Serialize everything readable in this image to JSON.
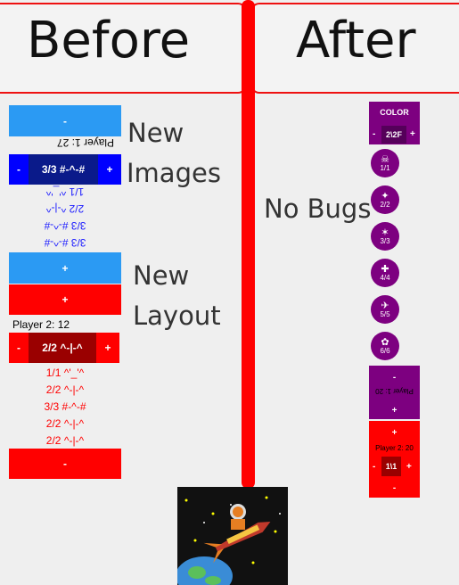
{
  "header": {
    "before": "Before",
    "after": "After"
  },
  "labels": {
    "new_images_1": "New",
    "new_images_2": "Images",
    "new_layout_1": "New",
    "new_layout_2": "Layout",
    "no_bugs": "No Bugs"
  },
  "before": {
    "p1": {
      "minus": "-",
      "name": "Player 1: 27",
      "dec": "-",
      "counter": "3/3 #-^-#",
      "inc": "+",
      "history": [
        "1/1 ^'_'^",
        "2/2 ^-|-^",
        "3/3 #-^-#",
        "3/3 #-^-#"
      ],
      "plus": "+"
    },
    "p2": {
      "plus": "+",
      "name": "Player 2:  12",
      "dec": "-",
      "counter": "2/2 ^-|-^",
      "inc": "+",
      "history": [
        "1/1 ^'_'^",
        "2/2 ^-|-^",
        "3/3 #-^-#",
        "2/2 ^-|-^",
        "2/2 ^-|-^"
      ],
      "minus": "-"
    }
  },
  "after": {
    "color_label": "COLOR",
    "top_dec": "-",
    "top_counter": "2\\2F",
    "top_inc": "+",
    "circles": [
      {
        "glyph": "☠",
        "text": "1/1"
      },
      {
        "glyph": "✦",
        "text": "2/2"
      },
      {
        "glyph": "✶",
        "text": "3/3"
      },
      {
        "glyph": "✚",
        "text": "4/4"
      },
      {
        "glyph": "✈",
        "text": "5/5"
      },
      {
        "glyph": "✿",
        "text": "6/6"
      }
    ],
    "p1_minus": "-",
    "p1_name": "Player 1: 20",
    "p1_plus": "+",
    "p2_plus": "+",
    "p2_name": "Player 2: 20",
    "p2_dec": "-",
    "p2_counter": "1\\1",
    "p2_inc": "+",
    "p2_minus": "-"
  },
  "colors": {
    "red": "#ff0000",
    "blue": "#2b9af3",
    "navy": "#0a1a8a",
    "purple": "#7d0080"
  }
}
